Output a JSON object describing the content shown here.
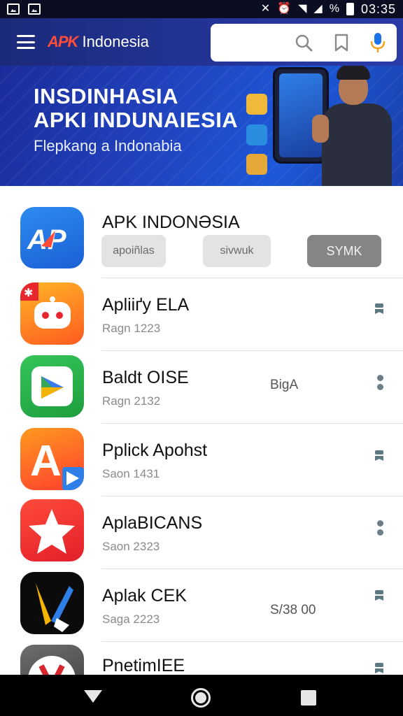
{
  "status_bar": {
    "time": "03:35",
    "signal_pct": "%"
  },
  "app_bar": {
    "brand_logo": "APK",
    "brand_name": "Indonesia"
  },
  "banner": {
    "title_line1": "INSDINHASIA",
    "title_line2": "APKI INDUNAIESIA",
    "subtitle": "Flepkang a Indonabia"
  },
  "list": {
    "featured": {
      "name": "APK INDONƏSIA",
      "actions": [
        "apoiñlas",
        "sivwuk",
        "SYMK"
      ]
    },
    "items": [
      {
        "name": "Apliiґy ELA",
        "sub": "Ragn 1223",
        "extra": "",
        "menu": "flag"
      },
      {
        "name": "Baldt OISE",
        "sub": "Ragn 2132",
        "extra": "BigA",
        "menu": "dots"
      },
      {
        "name": "Pplick Apohst",
        "sub": "Saon 1431",
        "extra": "",
        "menu": "flag"
      },
      {
        "name": "AplaBICANS",
        "sub": "Saon 2323",
        "extra": "",
        "menu": "dots"
      },
      {
        "name": "Aplak CEK",
        "sub": "Saga 2223",
        "extra": "S/38 00",
        "menu": "flag"
      },
      {
        "name": "PnetimIEE",
        "sub": "",
        "extra": "",
        "menu": "flag"
      }
    ]
  },
  "icons": {
    "menu": "hamburger-icon",
    "search": "search-icon",
    "bookmark": "bookmark-icon",
    "mic": "microphone-icon"
  },
  "colors": {
    "app_bar": "#24359a",
    "brand_accent": "#ff4d3a",
    "mic_blue": "#1a73e8",
    "mic_orange": "#f4a21b"
  }
}
